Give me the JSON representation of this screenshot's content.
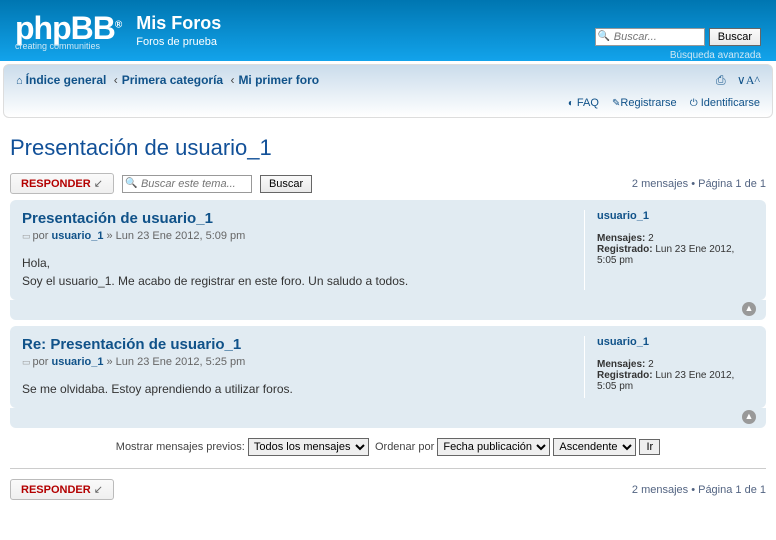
{
  "header": {
    "logo_main": "phpBB",
    "logo_reg": "®",
    "logo_sub": "creating  communities",
    "site_title": "Mis Foros",
    "site_desc": "Foros de prueba",
    "search_placeholder": "Buscar...",
    "search_btn": "Buscar",
    "adv_search": "Búsqueda avanzada"
  },
  "breadcrumb": {
    "home": "Índice general",
    "cat": "Primera categoría",
    "forum": "Mi primer foro"
  },
  "links": {
    "faq": "FAQ",
    "register": "Registrarse",
    "login": "Identificarse"
  },
  "topic": {
    "title": "Presentación de usuario_1",
    "reply": "RESPONDER",
    "search_placeholder": "Buscar este tema...",
    "search_btn": "Buscar",
    "pagination": "2 mensajes • Página 1 de 1"
  },
  "posts": [
    {
      "title": "Presentación de usuario_1",
      "by": "por ",
      "author": "usuario_1",
      "date": " » Lun 23 Ene 2012, 5:09 pm",
      "text": "Hola,\nSoy el usuario_1. Me acabo de registrar en este foro. Un saludo a todos.",
      "profile": {
        "name": "usuario_1",
        "msg_label": "Mensajes:",
        "msg_count": "2",
        "reg_label": "Registrado:",
        "reg_date": "Lun 23 Ene 2012, 5:05 pm"
      }
    },
    {
      "title": "Re: Presentación de usuario_1",
      "by": "por ",
      "author": "usuario_1",
      "date": " » Lun 23 Ene 2012, 5:25 pm",
      "text": "Se me olvidaba. Estoy aprendiendo a utilizar foros.",
      "profile": {
        "name": "usuario_1",
        "msg_label": "Mensajes:",
        "msg_count": "2",
        "reg_label": "Registrado:",
        "reg_date": "Lun 23 Ene 2012, 5:05 pm"
      }
    }
  ],
  "display": {
    "label_prev": "Mostrar mensajes previos:",
    "sel_all": "Todos los mensajes",
    "label_order": "Ordenar por",
    "sel_date": "Fecha publicación",
    "sel_asc": "Ascendente",
    "go": "Ir"
  }
}
